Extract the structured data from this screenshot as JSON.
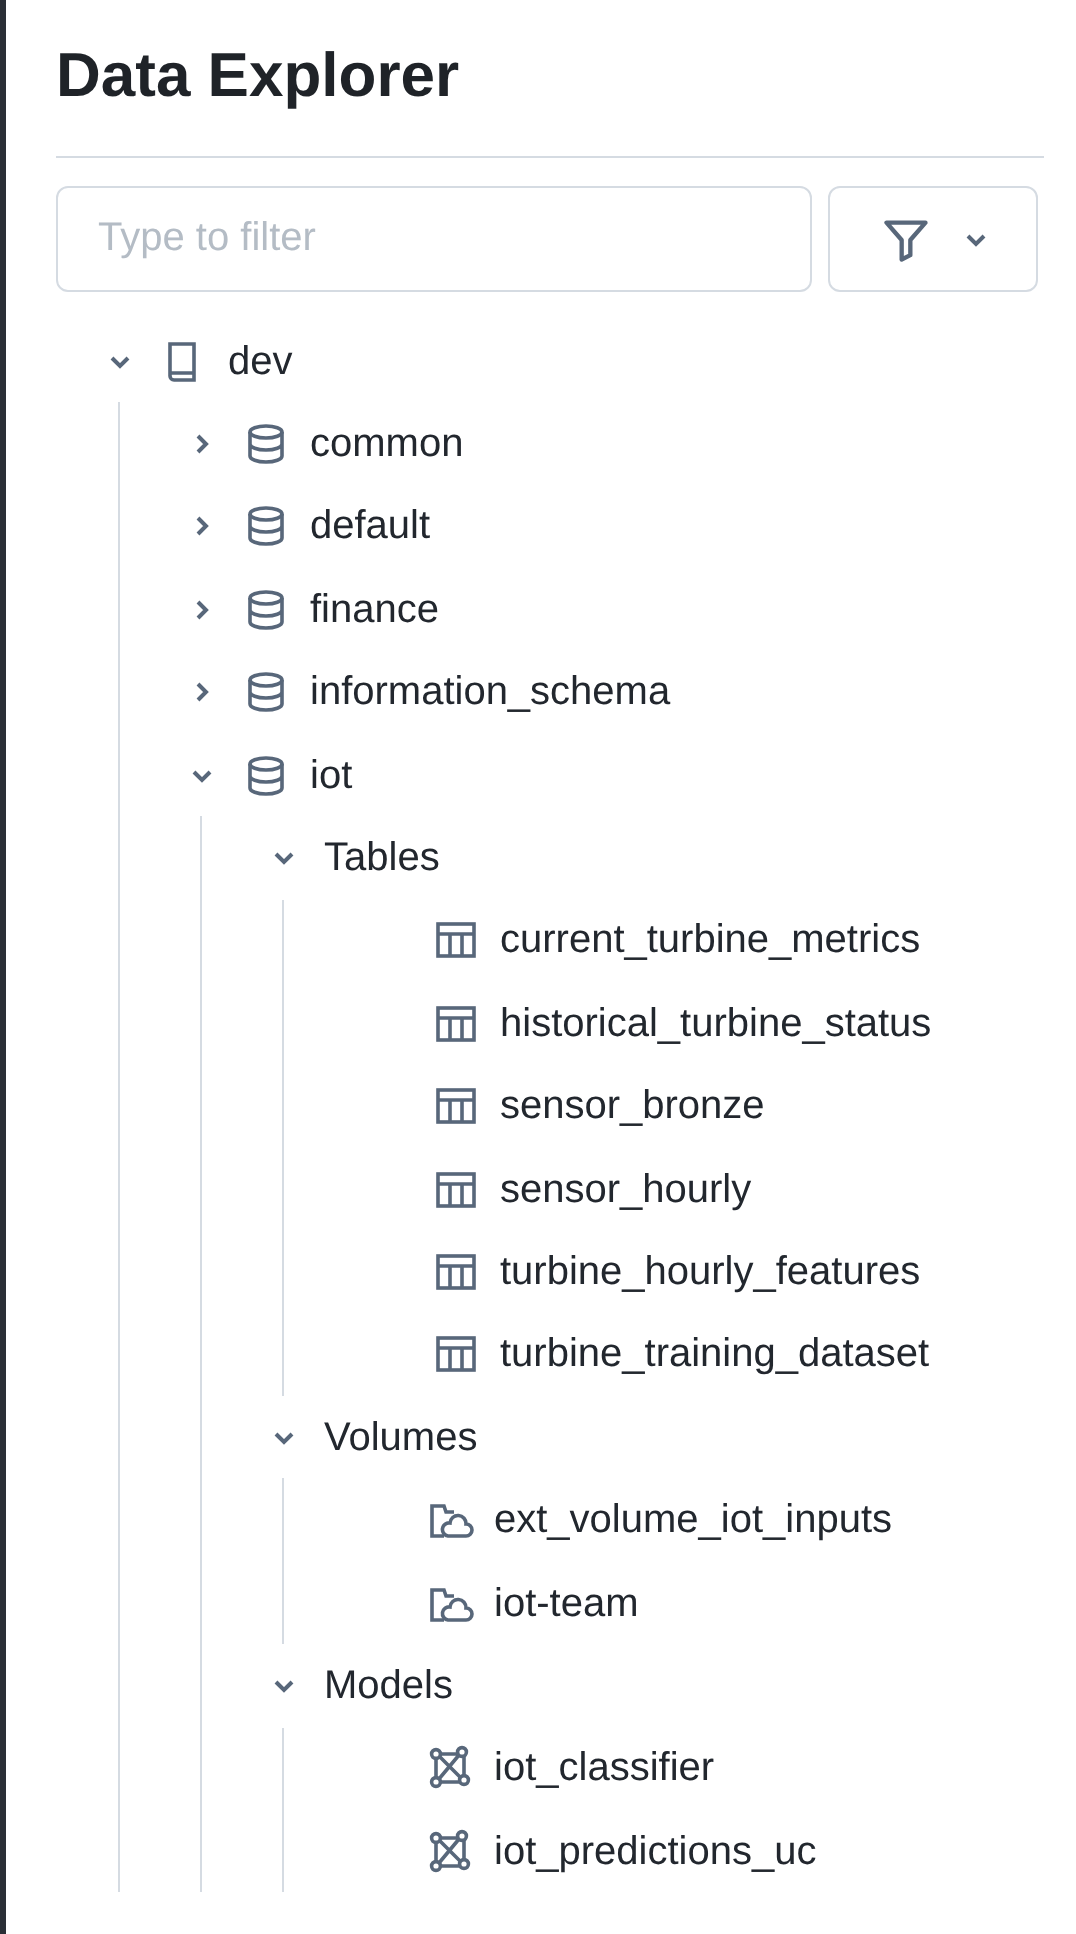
{
  "title": "Data Explorer",
  "filter": {
    "placeholder": "Type to filter"
  },
  "tree": [
    {
      "kind": "catalog",
      "label": "dev",
      "expanded": true,
      "children": [
        {
          "kind": "schema",
          "label": "common",
          "expanded": false
        },
        {
          "kind": "schema",
          "label": "default",
          "expanded": false
        },
        {
          "kind": "schema",
          "label": "finance",
          "expanded": false
        },
        {
          "kind": "schema",
          "label": "information_schema",
          "expanded": false
        },
        {
          "kind": "schema",
          "label": "iot",
          "expanded": true,
          "children": [
            {
              "kind": "group",
              "label": "Tables",
              "expanded": true,
              "children": [
                {
                  "kind": "table",
                  "label": "current_turbine_metrics"
                },
                {
                  "kind": "table",
                  "label": "historical_turbine_status"
                },
                {
                  "kind": "table",
                  "label": "sensor_bronze"
                },
                {
                  "kind": "table",
                  "label": "sensor_hourly"
                },
                {
                  "kind": "table",
                  "label": "turbine_hourly_features"
                },
                {
                  "kind": "table",
                  "label": "turbine_training_dataset"
                }
              ]
            },
            {
              "kind": "group",
              "label": "Volumes",
              "expanded": true,
              "children": [
                {
                  "kind": "volume",
                  "label": "ext_volume_iot_inputs"
                },
                {
                  "kind": "volume",
                  "label": "iot-team"
                }
              ]
            },
            {
              "kind": "group",
              "label": "Models",
              "expanded": true,
              "children": [
                {
                  "kind": "model",
                  "label": "iot_classifier"
                },
                {
                  "kind": "model",
                  "label": "iot_predictions_uc"
                }
              ]
            }
          ]
        }
      ]
    }
  ]
}
